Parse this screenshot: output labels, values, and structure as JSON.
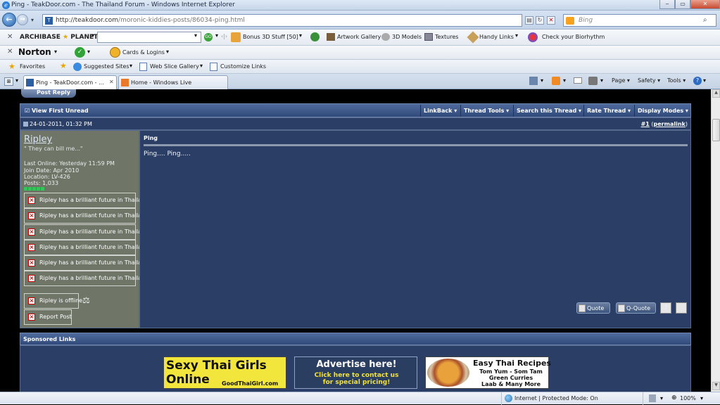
{
  "window": {
    "title": "Ping - TeakDoor.com - The Thailand Forum - Windows Internet Explorer",
    "min": "‒",
    "max": "▭",
    "close": "✕"
  },
  "address": {
    "url_main": "http://teakdoor.com",
    "url_rest": "/moronic-kiddies-posts/86034-ping.html",
    "search_placeholder": "Bing"
  },
  "toolbar1": {
    "brand": "ARCHIBASE",
    "brand2": "PLANET",
    "bonus": "Bonus 3D Stuff  [50]",
    "artwork": "Artwork Gallery",
    "models": "3D Models",
    "textures": "Textures",
    "handy": "Handy Links",
    "bio": "Check your Biorhythm"
  },
  "toolbar2": {
    "norton": "Norton",
    "cards": "Cards & Logins"
  },
  "favbar": {
    "favorites": "Favorites",
    "suggested": "Suggested Sites",
    "webslice": "Web Slice Gallery",
    "customize": "Customize Links"
  },
  "tabs": [
    {
      "label": "Ping - TeakDoor.com - ..."
    },
    {
      "label": "Home - Windows Live"
    }
  ],
  "cmdbar": {
    "page": "Page",
    "safety": "Safety",
    "tools": "Tools"
  },
  "forum": {
    "post_reply": "Post Reply",
    "view_first_unread": "View First Unread",
    "tools": [
      "LinkBack",
      "Thread Tools",
      "Search this Thread",
      "Rate Thread",
      "Display Modes"
    ],
    "post_date": "24-01-2011, 01:32 PM",
    "post_number": "#1",
    "permalink": "permalink",
    "user": {
      "name": "Ripley",
      "title": "\" They can bill me...\"",
      "last_online": "Last Online: Yesterday 11:59 PM",
      "join_date": "Join Date: Apr 2010",
      "location": "Location: LV-426",
      "posts": "Posts: 1,033",
      "reputation": [
        "Ripley has a brilliant future in Thailand",
        "Ripley has a brilliant future in Thailand",
        "Ripley has a brilliant future in Thailand",
        "Ripley has a brilliant future in Thailand",
        "Ripley has a brilliant future in Thailand",
        "Ripley has a brilliant future in Thailand"
      ],
      "status": "Ripley is offline",
      "report": "Report Post"
    },
    "post_title": "Ping",
    "post_body": "Ping.... Ping.....",
    "quote": "Quote",
    "qquote": "Q-Quote",
    "sponsored": "Sponsored Links",
    "ads": {
      "ad1_line1": "Sexy Thai Girls",
      "ad1_line2": "Online",
      "ad1_site": "GoodThaiGirl.com",
      "ad2_title": "Advertise here!",
      "ad2_line1": "Click here to contact us",
      "ad2_line2": "for special pricing!",
      "ad3_title": "Easy Thai Recipes",
      "ad3_line1": "Tom Yum - Som Tam",
      "ad3_line2": "Green Curries",
      "ad3_line3": "Laab & Many More"
    }
  },
  "status": {
    "zone": "Internet | Protected Mode: On",
    "zoom": "100%"
  }
}
